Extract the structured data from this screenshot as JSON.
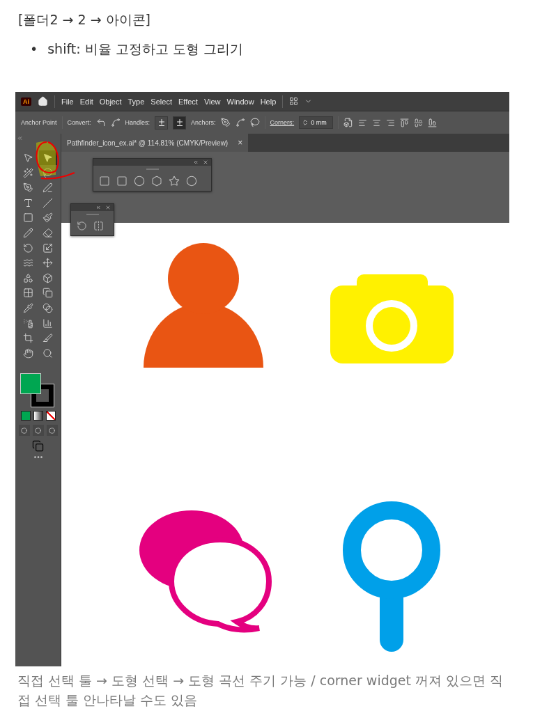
{
  "note": {
    "heading": "[폴더2 → 2 → 아이콘]",
    "bullets": [
      {
        "marker": "•",
        "text": "shift: 비율 고정하고 도형 그리기"
      }
    ]
  },
  "app": {
    "logo": "Ai",
    "menu": [
      "File",
      "Edit",
      "Object",
      "Type",
      "Select",
      "Effect",
      "View",
      "Window",
      "Help"
    ],
    "control_bar": {
      "title": "Anchor Point",
      "convert_label": "Convert:",
      "handles_label": "Handles:",
      "handles": [
        {
          "selected": false
        },
        {
          "selected": true
        }
      ],
      "anchors_label": "Anchors:",
      "corners_label": "Corners:",
      "corners_value": "0 mm"
    },
    "document_tab": {
      "title": "Pathfinder_icon_ex.ai* @ 114.81% (CMYK/Preview)",
      "close": "×"
    },
    "tools": [
      {
        "selected": false
      },
      {
        "selected": true
      },
      {
        "selected": false
      },
      {
        "selected": false
      },
      {
        "selected": false
      },
      {
        "selected": false
      },
      {
        "selected": false
      },
      {
        "selected": false
      },
      {
        "selected": false
      },
      {
        "selected": false
      },
      {
        "selected": false
      },
      {
        "selected": false
      },
      {
        "selected": false
      },
      {
        "selected": false
      },
      {
        "selected": false
      },
      {
        "selected": false
      },
      {
        "selected": false
      },
      {
        "selected": false
      },
      {
        "selected": false
      },
      {
        "selected": false
      },
      {
        "selected": false
      },
      {
        "selected": false
      },
      {
        "selected": false
      },
      {
        "selected": false
      },
      {
        "selected": false
      },
      {
        "selected": false
      },
      {
        "selected": false
      },
      {
        "selected": false
      }
    ]
  },
  "caption": "직접 선택 툴 → 도형 선택 → 도형 곡선 주기 가능 / corner widget 꺼져 있으면 직접 선택 툴 안나타날 수도 있음"
}
